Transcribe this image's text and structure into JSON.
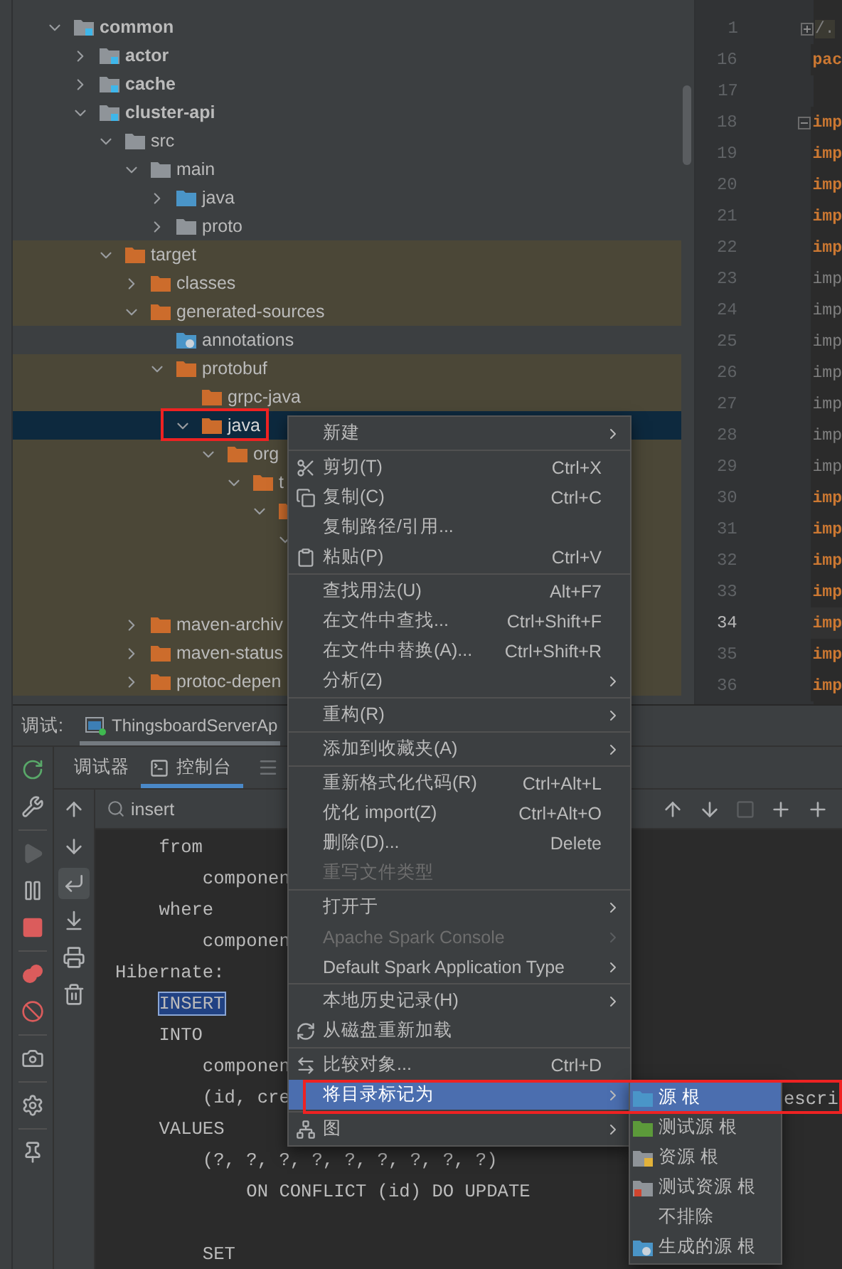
{
  "tree": [
    {
      "label": "common",
      "kind": "module",
      "expanded": true,
      "excluded": false,
      "selected": false,
      "children": [
        {
          "label": "actor",
          "kind": "module",
          "expanded": false,
          "excluded": false,
          "selected": false
        },
        {
          "label": "cache",
          "kind": "module",
          "expanded": false,
          "excluded": false,
          "selected": false
        },
        {
          "label": "cluster-api",
          "kind": "module",
          "expanded": true,
          "excluded": false,
          "selected": false,
          "children": [
            {
              "label": "src",
              "kind": "folder",
              "expanded": true,
              "excluded": false,
              "selected": false,
              "children": [
                {
                  "label": "main",
                  "kind": "folder",
                  "expanded": true,
                  "excluded": false,
                  "selected": false,
                  "children": [
                    {
                      "label": "java",
                      "kind": "source",
                      "expanded": false,
                      "excluded": false,
                      "selected": false
                    },
                    {
                      "label": "proto",
                      "kind": "folder",
                      "expanded": false,
                      "excluded": false,
                      "selected": false
                    }
                  ]
                }
              ]
            },
            {
              "label": "target",
              "kind": "excluded",
              "expanded": true,
              "excluded": true,
              "selected": false,
              "children": [
                {
                  "label": "classes",
                  "kind": "excluded",
                  "expanded": false,
                  "excluded": true,
                  "selected": false
                },
                {
                  "label": "generated-sources",
                  "kind": "excluded",
                  "expanded": true,
                  "excluded": true,
                  "selected": false,
                  "children": [
                    {
                      "label": "annotations",
                      "kind": "generated",
                      "excluded": false,
                      "selected": false
                    },
                    {
                      "label": "protobuf",
                      "kind": "excluded",
                      "expanded": true,
                      "excluded": true,
                      "selected": false,
                      "children": [
                        {
                          "label": "grpc-java",
                          "kind": "excluded",
                          "excluded": true,
                          "selected": false
                        },
                        {
                          "label": "java",
                          "kind": "excluded",
                          "expanded": true,
                          "selected": true,
                          "children": [
                            {
                              "label": "org",
                              "kind": "excluded",
                              "expanded": true,
                              "excluded": true,
                              "selected": false,
                              "children": [
                                {
                                  "label": "t",
                                  "kind": "excluded",
                                  "expanded": true,
                                  "excluded": true,
                                  "selected": false,
                                  "children": [
                                    {
                                      "kind": "excluded",
                                      "expanded": true,
                                      "excluded": true,
                                      "selected": false,
                                      "children": [
                                        {
                                          "expanded": true,
                                          "excluded": true,
                                          "selected": false,
                                          "children": [
                                            {
                                              "excluded": true,
                                              "selected": false
                                            },
                                            {
                                              "excluded": true,
                                              "selected": false
                                            }
                                          ]
                                        }
                                      ]
                                    }
                                  ]
                                }
                              ]
                            }
                          ]
                        }
                      ]
                    }
                  ]
                },
                {
                  "label": "maven-archiv",
                  "kind": "excluded",
                  "expanded": false,
                  "excluded": true,
                  "selected": false
                },
                {
                  "label": "maven-status",
                  "kind": "excluded",
                  "expanded": false,
                  "excluded": true,
                  "selected": false
                },
                {
                  "label": "protoc-depen",
                  "kind": "excluded",
                  "expanded": false,
                  "excluded": true,
                  "selected": false
                }
              ]
            }
          ]
        }
      ]
    }
  ],
  "editor_lines": [
    {
      "number": "1",
      "text": "/.",
      "kind": "comment",
      "collapsed": true,
      "current": false
    },
    {
      "number": "16",
      "text": "pac",
      "kind": "keyword",
      "current": false
    },
    {
      "number": "17",
      "current": false
    },
    {
      "number": "18",
      "text": "imp",
      "kind": "keyword",
      "collapsed": false,
      "current": false
    },
    {
      "number": "19",
      "text": "imp",
      "kind": "keyword",
      "current": false
    },
    {
      "number": "20",
      "text": "imp",
      "kind": "keyword",
      "current": false
    },
    {
      "number": "21",
      "text": "imp",
      "kind": "keyword",
      "current": false
    },
    {
      "number": "22",
      "text": "imp",
      "kind": "keyword",
      "current": false
    },
    {
      "number": "23",
      "text": "imp",
      "kind": "unused",
      "current": false
    },
    {
      "number": "24",
      "text": "imp",
      "kind": "unused",
      "current": false
    },
    {
      "number": "25",
      "text": "imp",
      "kind": "unused",
      "current": false
    },
    {
      "number": "26",
      "text": "imp",
      "kind": "unused",
      "current": false
    },
    {
      "number": "27",
      "text": "imp",
      "kind": "unused",
      "current": false
    },
    {
      "number": "28",
      "text": "imp",
      "kind": "unused",
      "current": false
    },
    {
      "number": "29",
      "text": "imp",
      "kind": "unused",
      "current": false
    },
    {
      "number": "30",
      "text": "imp",
      "kind": "keyword",
      "current": false
    },
    {
      "number": "31",
      "text": "imp",
      "kind": "keyword",
      "current": false
    },
    {
      "number": "32",
      "text": "imp",
      "kind": "keyword",
      "current": false
    },
    {
      "number": "33",
      "text": "imp",
      "kind": "keyword",
      "current": false
    },
    {
      "number": "34",
      "text": "imp",
      "kind": "keyword",
      "current": true
    },
    {
      "number": "35",
      "text": "imp",
      "kind": "keyword",
      "current": false
    },
    {
      "number": "36",
      "text": "imp",
      "kind": "keyword",
      "current": false
    }
  ],
  "debug_panel": {
    "title": "调试:",
    "sessions": [
      {
        "label": "ThingsboardServerAp",
        "selected": true
      }
    ],
    "tabs": [
      {
        "label": "调试器",
        "selected": false
      },
      {
        "label": "控制台",
        "selected": true
      }
    ],
    "actions": [
      {
        "disabled": false
      },
      {
        "disabled": false
      },
      {
        "disabled": true
      },
      {
        "disabled": false
      },
      {
        "disabled": false
      },
      {
        "disabled": false
      },
      {
        "disabled": false
      },
      {
        "disabled": false
      },
      {
        "disabled": false
      },
      {
        "disabled": false
      }
    ],
    "console_actions": [
      {
        "selected": false
      },
      {
        "selected": false
      },
      {
        "selected": true
      },
      {
        "selected": false
      },
      {
        "selected": false
      },
      {
        "selected": false
      }
    ],
    "search": {
      "value": "insert"
    },
    "console_lines": [
      {
        "kind": "text",
        "text": "    from"
      },
      {
        "kind": "text",
        "text": "        componen"
      },
      {
        "kind": "text",
        "text": "    where"
      },
      {
        "kind": "text",
        "text": "        componen"
      },
      {
        "kind": "text",
        "text": "Hibernate:"
      },
      {
        "kind": "match",
        "text": "    INSERT"
      },
      {
        "kind": "text",
        "text": "    INTO"
      },
      {
        "kind": "text",
        "text": "        componen"
      },
      {
        "kind": "text",
        "text": "        (id, cre",
        "tail": "escri"
      },
      {
        "kind": "text",
        "text": "    VALUES"
      },
      {
        "kind": "text",
        "text": "        (?, ?, ?, ?, ?, ?, ?, ?, ?)"
      },
      {
        "kind": "text",
        "text": "            ON CONFLICT (id) DO UPDATE"
      },
      {
        "kind": "blank"
      },
      {
        "kind": "text",
        "text": "        SET"
      }
    ]
  },
  "context_menu": {
    "groups": [
      [
        {
          "label": "新建",
          "submenu": true,
          "disabled": false,
          "selected": false
        }
      ],
      [
        {
          "label": "剪切(T)",
          "shortcut": "Ctrl+X",
          "submenu": false,
          "disabled": false,
          "selected": false
        },
        {
          "label": "复制(C)",
          "shortcut": "Ctrl+C",
          "submenu": false,
          "disabled": false,
          "selected": false
        },
        {
          "label": "复制路径/引用...",
          "submenu": false,
          "disabled": false,
          "selected": false
        },
        {
          "label": "粘贴(P)",
          "shortcut": "Ctrl+V",
          "submenu": false,
          "disabled": false,
          "selected": false
        }
      ],
      [
        {
          "label": "查找用法(U)",
          "shortcut": "Alt+F7",
          "submenu": false,
          "disabled": false,
          "selected": false
        },
        {
          "label": "在文件中查找...",
          "shortcut": "Ctrl+Shift+F",
          "submenu": false,
          "disabled": false,
          "selected": false
        },
        {
          "label": "在文件中替换(A)...",
          "shortcut": "Ctrl+Shift+R",
          "submenu": false,
          "disabled": false,
          "selected": false
        },
        {
          "label": "分析(Z)",
          "submenu": true,
          "disabled": false,
          "selected": false
        }
      ],
      [
        {
          "label": "重构(R)",
          "submenu": true,
          "disabled": false,
          "selected": false
        }
      ],
      [
        {
          "label": "添加到收藏夹(A)",
          "submenu": true,
          "disabled": false,
          "selected": false
        }
      ],
      [
        {
          "label": "重新格式化代码(R)",
          "shortcut": "Ctrl+Alt+L",
          "submenu": false,
          "disabled": false,
          "selected": false
        },
        {
          "label": "优化 import(Z)",
          "shortcut": "Ctrl+Alt+O",
          "submenu": false,
          "disabled": false,
          "selected": false
        },
        {
          "label": "删除(D)...",
          "shortcut": "Delete",
          "submenu": false,
          "disabled": false,
          "selected": false
        },
        {
          "label": "重写文件类型",
          "submenu": false,
          "disabled": true,
          "selected": false
        }
      ],
      [
        {
          "label": "打开于",
          "submenu": true,
          "disabled": false,
          "selected": false
        },
        {
          "label": "Apache Spark Console",
          "submenu": true,
          "disabled": true,
          "selected": false
        },
        {
          "label": "Default Spark Application Type",
          "submenu": true,
          "disabled": false,
          "selected": false
        }
      ],
      [
        {
          "label": "本地历史记录(H)",
          "submenu": true,
          "disabled": false,
          "selected": false
        },
        {
          "label": "从磁盘重新加载",
          "submenu": false,
          "disabled": false,
          "selected": false
        }
      ],
      [
        {
          "label": "比较对象...",
          "shortcut": "Ctrl+D",
          "submenu": false,
          "disabled": false,
          "selected": false
        },
        {
          "label": "将目录标记为",
          "submenu": true,
          "disabled": false,
          "selected": true
        }
      ],
      [
        {
          "label": "图",
          "submenu": true,
          "disabled": false,
          "selected": false
        }
      ]
    ]
  },
  "submenu": [
    {
      "label": "源 根",
      "selected": true
    },
    {
      "label": "测试源 根",
      "selected": false
    },
    {
      "label": "资源 根",
      "selected": false
    },
    {
      "label": "测试资源 根",
      "selected": false
    },
    {
      "label": "不排除",
      "selected": false
    },
    {
      "label": "生成的源 根",
      "selected": false
    }
  ]
}
